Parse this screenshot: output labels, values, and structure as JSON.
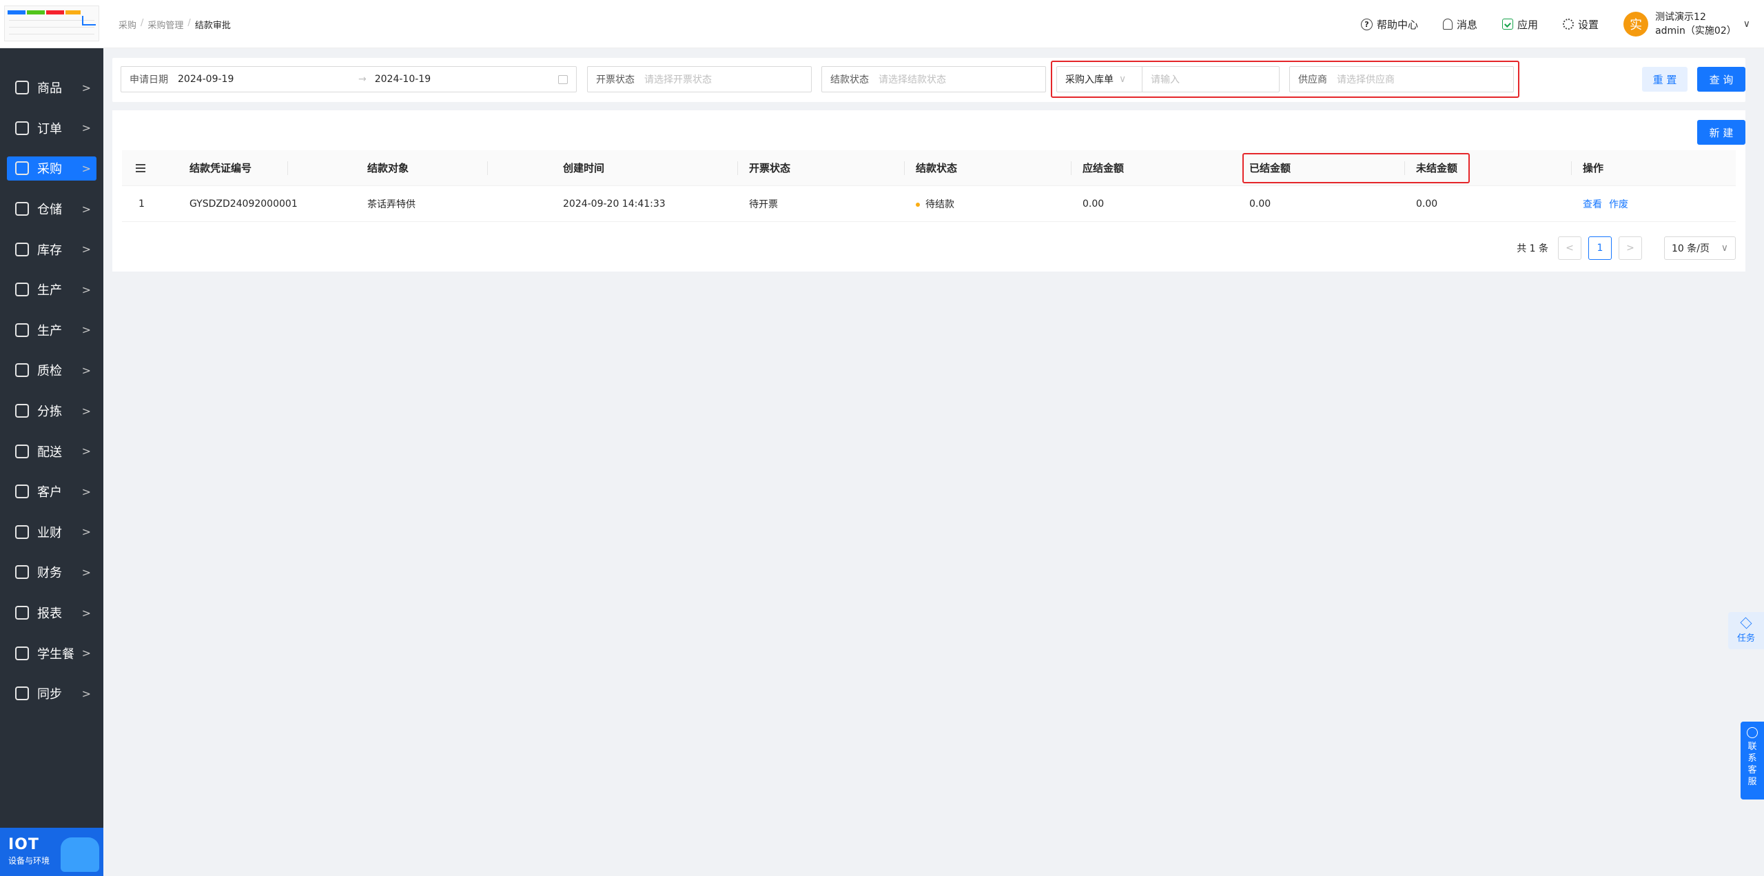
{
  "sidebar": {
    "items": [
      {
        "label": "商品",
        "icon": "grid-icon"
      },
      {
        "label": "订单",
        "icon": "clipboard-icon"
      },
      {
        "label": "采购",
        "icon": "basket-icon",
        "active": true
      },
      {
        "label": "仓储",
        "icon": "warehouse-icon"
      },
      {
        "label": "库存",
        "icon": "stock-icon"
      },
      {
        "label": "生产",
        "icon": "factory-icon"
      },
      {
        "label": "生产",
        "icon": "factory-icon"
      },
      {
        "label": "质检",
        "icon": "shield-icon"
      },
      {
        "label": "分拣",
        "icon": "sort-icon"
      },
      {
        "label": "配送",
        "icon": "truck-icon"
      },
      {
        "label": "客户",
        "icon": "customer-icon"
      },
      {
        "label": "业财",
        "icon": "chart-icon"
      },
      {
        "label": "财务",
        "icon": "finance-icon"
      },
      {
        "label": "报表",
        "icon": "clock-icon"
      },
      {
        "label": "学生餐",
        "icon": "meal-icon"
      },
      {
        "label": "同步",
        "icon": "sync-icon"
      }
    ],
    "arrow": ">",
    "iot": {
      "title": "IOT",
      "subtitle": "设备与环境"
    }
  },
  "header": {
    "breadcrumb": [
      "采购",
      "采购管理",
      "结款审批"
    ],
    "breadcrumb_sep": "/",
    "help": "帮助中心",
    "messages": "消息",
    "apps": "应用",
    "settings": "设置",
    "user_avatar": "实",
    "user_name": "测试演示12",
    "user_role": "admin（实施02）"
  },
  "filters": {
    "date_label": "申请日期",
    "date_start": "2024-09-19",
    "date_arrow": "→",
    "date_end": "2024-10-19",
    "invoice_label": "开票状态",
    "invoice_placeholder": "请选择开票状态",
    "settle_label": "结款状态",
    "settle_placeholder": "请选择结款状态",
    "doc_type": "采购入库单",
    "doc_type_arrow": "∨",
    "doc_input_placeholder": "请输入",
    "supplier_label": "供应商",
    "supplier_placeholder": "请选择供应商",
    "reset": "重 置",
    "query": "查 询"
  },
  "toolbar": {
    "new": "新 建"
  },
  "table": {
    "columns": [
      "结款凭证编号",
      "结款对象",
      "创建时间",
      "开票状态",
      "结款状态",
      "应结金额",
      "已结金额",
      "未结金额",
      "操作"
    ],
    "rows": [
      {
        "index": "1",
        "code": "GYSDZD24092000001",
        "target": "茶话弄特供",
        "created": "2024-09-20 14:41:33",
        "invoice_status": "待开票",
        "settle_status": "待结款",
        "payable": "0.00",
        "settled": "0.00",
        "unsettled": "0.00",
        "actions": [
          "查看",
          "作废"
        ]
      }
    ]
  },
  "pagination": {
    "total": "共 1 条",
    "prev": "<",
    "current": "1",
    "next": ">",
    "page_size": "10 条/页",
    "size_arrow": "∨"
  },
  "floating": {
    "task": "任务",
    "service": [
      "联",
      "系",
      "客",
      "服"
    ]
  }
}
